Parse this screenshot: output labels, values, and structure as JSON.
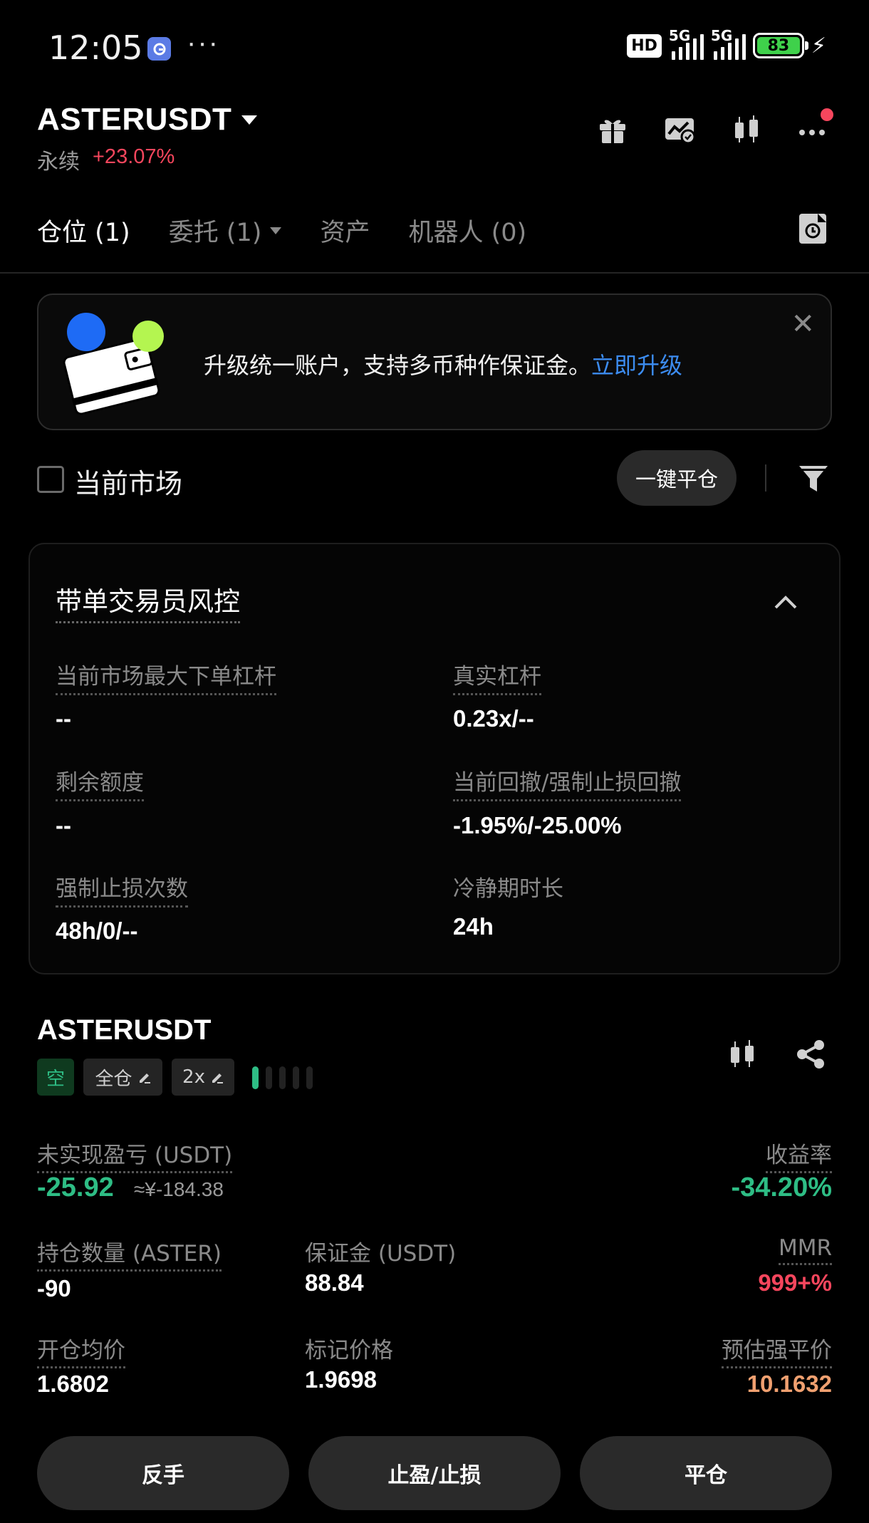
{
  "status_bar": {
    "time": "12:05",
    "more": "···",
    "hd": "HD",
    "net1": "5G",
    "net2": "5G",
    "battery": "83"
  },
  "header": {
    "symbol": "ASTERUSDT",
    "contract_type": "永续",
    "change": "+23.07%",
    "icons": [
      "gift-icon",
      "chart-settings-icon",
      "candlestick-icon",
      "more-icon"
    ]
  },
  "tabs": [
    {
      "label": "仓位 (1)",
      "active": true
    },
    {
      "label": "委托 (1)",
      "active": false
    },
    {
      "label": "资产",
      "active": false
    },
    {
      "label": "机器人 (0)",
      "active": false
    }
  ],
  "banner": {
    "text": "升级统一账户，支持多币种作保证金。",
    "link": "立即升级"
  },
  "filter": {
    "current_market": "当前市场",
    "close_all": "一键平仓"
  },
  "risk": {
    "title": "带单交易员风控",
    "items": [
      {
        "label": "当前市场最大下单杠杆",
        "value": "--"
      },
      {
        "label": "真实杠杆",
        "value": "0.23x/--"
      },
      {
        "label": "剩余额度",
        "value": "--"
      },
      {
        "label": "当前回撤/强制止损回撤",
        "value": "-1.95%/-25.00%"
      },
      {
        "label": "强制止损次数",
        "value": "48h/0/--"
      },
      {
        "label": "冷静期时长",
        "value": "24h"
      }
    ]
  },
  "position": {
    "symbol": "ASTERUSDT",
    "side": "空",
    "margin_mode": "全仓",
    "leverage": "2x",
    "adl_level": 1,
    "unrealized_pnl_label": "未实现盈亏 (USDT)",
    "unrealized_pnl": "-25.92",
    "unrealized_pnl_cny": "≈¥-184.38",
    "roe_label": "收益率",
    "roe": "-34.20%",
    "size_label": "持仓数量 (ASTER)",
    "size": "-90",
    "margin_label": "保证金 (USDT)",
    "margin": "88.84",
    "mmr_label": "MMR",
    "mmr": "999+%",
    "entry_label": "开仓均价",
    "entry": "1.6802",
    "mark_label": "标记价格",
    "mark": "1.9698",
    "liq_label": "预估强平价",
    "liq": "10.1632"
  },
  "actions": {
    "reverse": "反手",
    "tpsl": "止盈/止损",
    "close": "平仓"
  },
  "colors": {
    "green": "#2ebd85",
    "red": "#f6465d",
    "link": "#3c8cf0",
    "orange": "#f0a070"
  }
}
